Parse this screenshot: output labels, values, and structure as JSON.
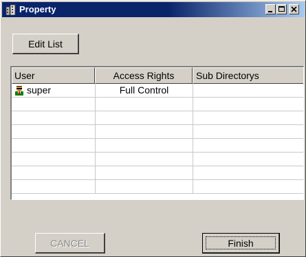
{
  "window": {
    "title": "Property",
    "controls": [
      "minimize-icon",
      "maximize-icon",
      "close-icon"
    ]
  },
  "toolbar": {
    "edit_list_label": "Edit List"
  },
  "table": {
    "columns": [
      "User",
      "Access Rights",
      "Sub Directorys"
    ],
    "rows": [
      {
        "user": "super",
        "access": "Full Control",
        "sub": "",
        "icon": "user-avatar-icon"
      },
      {
        "user": "",
        "access": "",
        "sub": ""
      },
      {
        "user": "",
        "access": "",
        "sub": ""
      },
      {
        "user": "",
        "access": "",
        "sub": ""
      },
      {
        "user": "",
        "access": "",
        "sub": ""
      },
      {
        "user": "",
        "access": "",
        "sub": ""
      },
      {
        "user": "",
        "access": "",
        "sub": ""
      },
      {
        "user": "",
        "access": "",
        "sub": ""
      }
    ]
  },
  "footer": {
    "cancel_label": "CANCEL",
    "cancel_enabled": false,
    "finish_label": "Finish"
  },
  "colors": {
    "titlebar_start": "#0a246a",
    "titlebar_end": "#a6caf0",
    "face": "#d4d0c8"
  }
}
